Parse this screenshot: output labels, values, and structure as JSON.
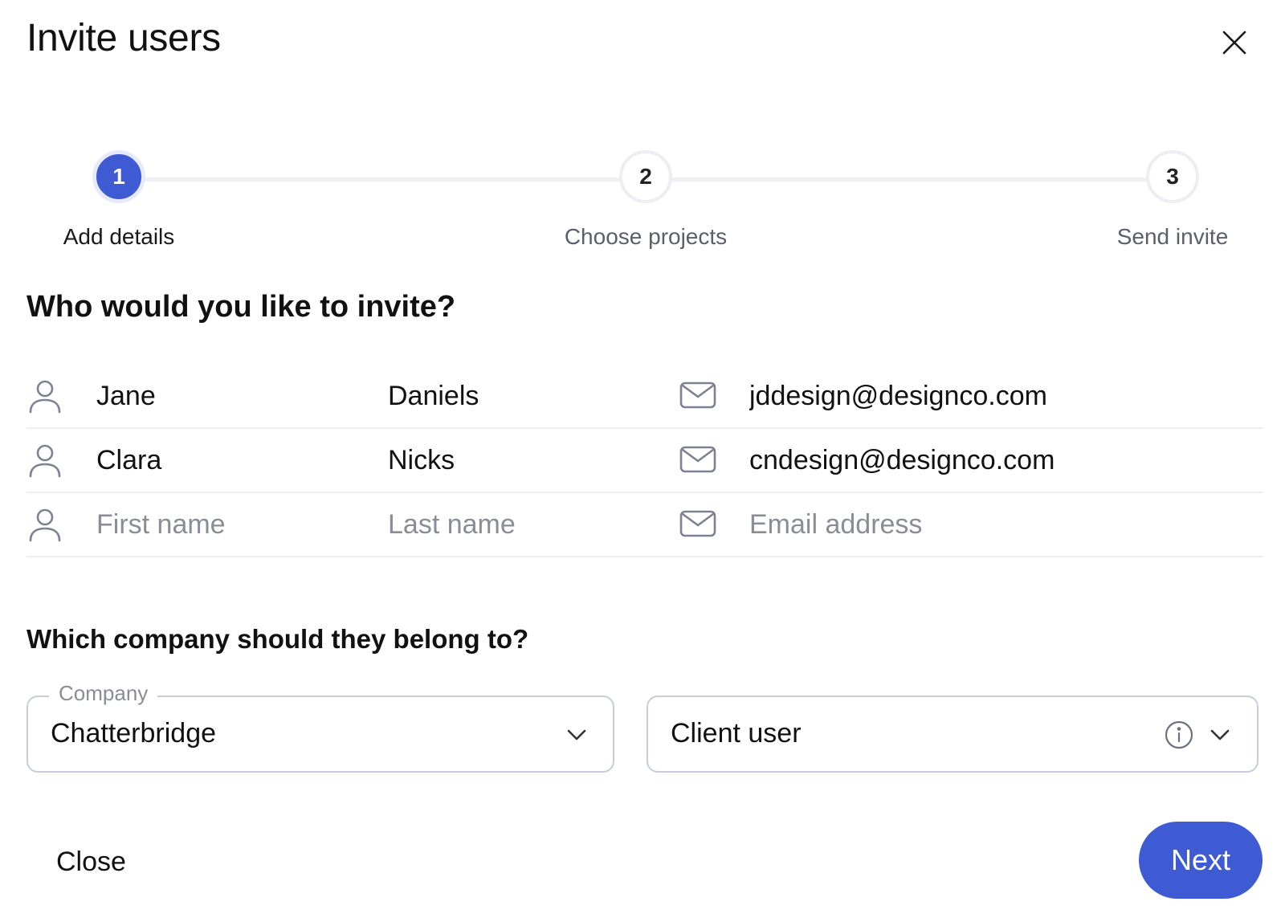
{
  "dialog": {
    "title": "Invite users",
    "close_icon": "close-icon"
  },
  "stepper": {
    "steps": [
      {
        "number": "1",
        "label": "Add details",
        "state": "active"
      },
      {
        "number": "2",
        "label": "Choose projects",
        "state": "inactive"
      },
      {
        "number": "3",
        "label": "Send invite",
        "state": "inactive"
      }
    ]
  },
  "invitees": {
    "heading": "Who would you like to invite?",
    "rows": [
      {
        "first_name": "Jane",
        "last_name": "Daniels",
        "email": "jddesign@designco.com"
      },
      {
        "first_name": "Clara",
        "last_name": "Nicks",
        "email": "cndesign@designco.com"
      },
      {
        "first_name": "",
        "last_name": "",
        "email": ""
      }
    ],
    "placeholders": {
      "first_name": "First name",
      "last_name": "Last name",
      "email": "Email address"
    },
    "icons": {
      "person": "person-icon",
      "mail": "mail-icon"
    }
  },
  "company": {
    "heading": "Which company should they belong to?",
    "company_label": "Company",
    "company_value": "Chatterbridge",
    "role_value": "Client user",
    "icons": {
      "chevron": "chevron-down-icon",
      "info": "info-icon"
    }
  },
  "footer": {
    "close_label": "Close",
    "next_label": "Next"
  },
  "colors": {
    "accent": "#3f5bd3",
    "accent_ring": "#e7eafb",
    "border": "#c8ccdc",
    "divider": "#eceef2",
    "placeholder": "#8a8d96",
    "muted_text": "#5b5f6b",
    "icon_stroke": "#7c8194"
  }
}
